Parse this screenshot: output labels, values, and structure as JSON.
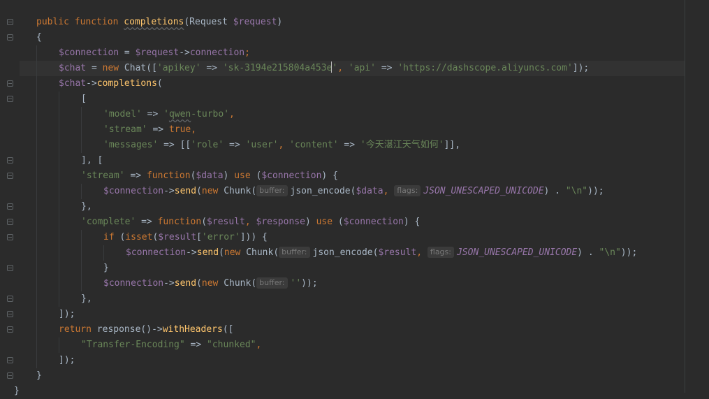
{
  "colors": {
    "background": "#2b2b2b",
    "keyword": "#cc7832",
    "function": "#ffc66d",
    "variable": "#9876aa",
    "string": "#6a8759",
    "text": "#a9b7c6"
  },
  "code": {
    "l1": {
      "kw1": "public",
      "kw2": "function",
      "name": "completions",
      "p1": "(Request ",
      "var": "$request",
      "p2": ")"
    },
    "l2": {
      "t": "{"
    },
    "l3": {
      "v1": "$connection",
      "op": " = ",
      "v2": "$request",
      "arrow": "->",
      "prop": "connection",
      "end": ";"
    },
    "l4": {
      "v1": "$chat",
      "op": " = ",
      "kw": "new",
      "cls": " Chat([",
      "s1": "'apikey'",
      "a1": " => ",
      "s2a": "'sk-3194e215804a453e",
      "s2b": "'",
      "c1": ", ",
      "s3": "'api'",
      "a2": " => ",
      "s4": "'https://dashscope.aliyuncs.com'",
      "end": "]);"
    },
    "l5": {
      "v1": "$chat",
      "arrow": "->",
      "fn": "completions",
      "end": "("
    },
    "l6": {
      "t": "["
    },
    "l7": {
      "s1": "'model'",
      "a": " => ",
      "s2a": "'",
      "s2b": "qwen",
      "s2c": "-turbo'",
      "end": ","
    },
    "l8": {
      "s1": "'stream'",
      "a": " => ",
      "kw": "true",
      "end": ","
    },
    "l9": {
      "s1": "'messages'",
      "a": " => [[",
      "s2": "'role'",
      "a2": " => ",
      "s3": "'user'",
      "c": ", ",
      "s4": "'content'",
      "a3": " => ",
      "s5": "'今天湛江天气如何'",
      "end": "]],"
    },
    "l10": {
      "t": "], ["
    },
    "l11": {
      "s1": "'stream'",
      "a": " => ",
      "kw": "function",
      "p1": "(",
      "v1": "$data",
      "p2": ") ",
      "kw2": "use",
      "p3": " (",
      "v2": "$connection",
      "p4": ") {"
    },
    "l12": {
      "v1": "$connection",
      "arrow": "->",
      "fn": "send",
      "p1": "(",
      "kw": "new",
      "cls": " Chunk(",
      "hint1": "buffer:",
      "fn2": "json_encode(",
      "v2": "$data",
      "c": ", ",
      "hint2": "flags:",
      "const": "JSON_UNESCAPED_UNICODE",
      "p2": ") . ",
      "s": "\"\\n\"",
      "end": "));"
    },
    "l13": {
      "t": "},"
    },
    "l14": {
      "s1": "'complete'",
      "a": " => ",
      "kw": "function",
      "p1": "(",
      "v1": "$result",
      "c": ", ",
      "v2": "$response",
      "p2": ") ",
      "kw2": "use",
      "p3": " (",
      "v3": "$connection",
      "p4": ") {"
    },
    "l15": {
      "kw": "if",
      "p1": " (",
      "fn": "isset",
      "p2": "(",
      "v": "$result",
      "p3": "[",
      "s": "'error'",
      "p4": "])) {"
    },
    "l16": {
      "v1": "$connection",
      "arrow": "->",
      "fn": "send",
      "p1": "(",
      "kw": "new",
      "cls": " Chunk(",
      "hint1": "buffer:",
      "fn2": "json_encode(",
      "v2": "$result",
      "c": ", ",
      "hint2": "flags:",
      "const": "JSON_UNESCAPED_UNICODE",
      "p2": ") . ",
      "s": "\"\\n\"",
      "end": "));"
    },
    "l17": {
      "t": "}"
    },
    "l18": {
      "v1": "$connection",
      "arrow": "->",
      "fn": "send",
      "p1": "(",
      "kw": "new",
      "cls": " Chunk(",
      "hint1": "buffer:",
      "s": "''",
      "end": "));"
    },
    "l19": {
      "t": "},"
    },
    "l20": {
      "t": "]);"
    },
    "l21": {
      "kw": "return",
      "fn1": " response()",
      "arrow": "->",
      "fn2": "withHeaders",
      "end": "(["
    },
    "l22": {
      "s1": "\"Transfer-Encoding\"",
      "a": " => ",
      "s2": "\"chunked\"",
      "end": ","
    },
    "l23": {
      "t": "]);"
    },
    "l24": {
      "t": "}"
    },
    "l25": {
      "t": "}"
    }
  }
}
